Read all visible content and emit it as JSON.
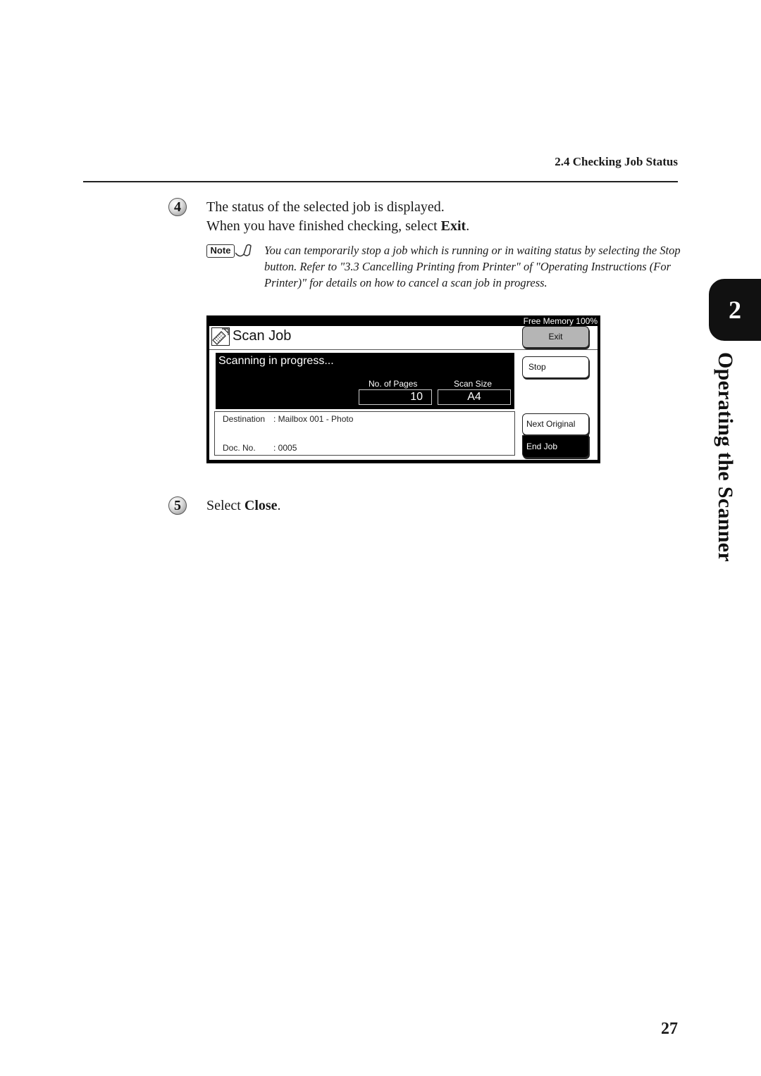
{
  "header": {
    "section": "2.4  Checking Job Status"
  },
  "steps": [
    {
      "number": "4",
      "line1": "The status of the selected job is displayed.",
      "line2_prefix": "When you have finished checking, select ",
      "line2_bold": "Exit",
      "line2_suffix": "."
    },
    {
      "number": "5",
      "prefix": "Select ",
      "bold": "Close",
      "suffix": "."
    }
  ],
  "note": {
    "badge": "Note",
    "icon": "pencil-note-icon",
    "text": "You can temporarily stop a job which is running or in waiting status by selecting the Stop button. Refer to \"3.3  Cancelling Printing from Printer\" of \"Operating Instructions (For Printer)\" for details on how to cancel a scan job in progress."
  },
  "screen": {
    "free_memory": "Free Memory  100%",
    "title": "Scan Job",
    "title_icon": "scanner-icon",
    "buttons": {
      "exit": "Exit",
      "stop": "Stop",
      "next_original": "Next Original",
      "end_job": "End Job"
    },
    "status": "Scanning in progress...",
    "pages_label": "No. of Pages",
    "pages_value": "10",
    "size_label": "Scan Size",
    "size_value": "A4",
    "destination_label": "Destination",
    "destination_value": ": Mailbox 001 - Photo",
    "doc_label": "Doc. No.",
    "doc_value": ": 0005"
  },
  "side_tab": {
    "chapter": "2",
    "title": "Operating the Scanner"
  },
  "page_number": "27"
}
